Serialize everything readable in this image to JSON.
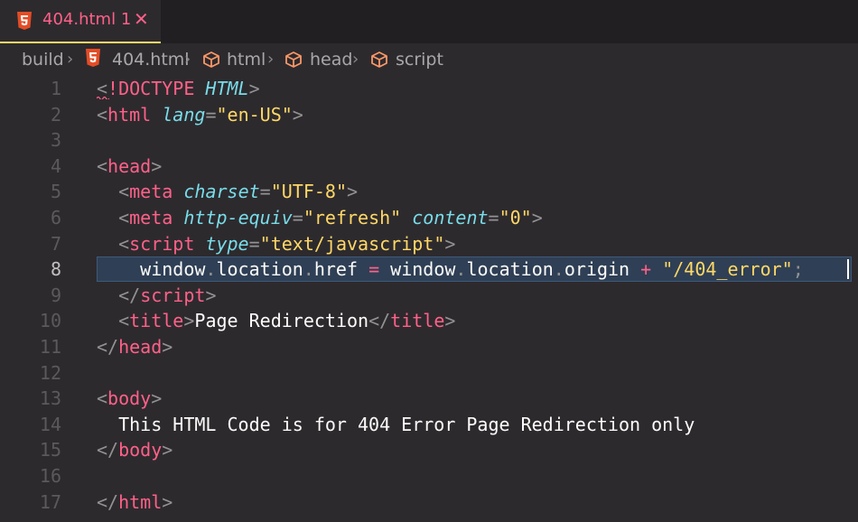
{
  "tab": {
    "filename": "404.html",
    "problem_count": "1",
    "close_glyph": "✕"
  },
  "breadcrumb": {
    "items": [
      "build",
      "404.html",
      "html",
      "head",
      "script"
    ],
    "separator": "›"
  },
  "colors": {
    "background": "#2d2a2e",
    "tag": "#ff6188",
    "attribute": "#78dce8",
    "string": "#ffd866",
    "punctuation": "#939293",
    "text": "#fcfcfa",
    "accent": "#ffd866"
  },
  "editor": {
    "active_line": "8",
    "lines": [
      {
        "n": "1",
        "parts": [
          [
            "p",
            "<"
          ],
          [
            "d",
            "!DOCTYPE"
          ],
          [
            "w",
            " "
          ],
          [
            "a",
            "HTML"
          ],
          [
            "p",
            ">"
          ]
        ]
      },
      {
        "n": "2",
        "parts": [
          [
            "p",
            "<"
          ],
          [
            "t",
            "html"
          ],
          [
            "w",
            " "
          ],
          [
            "a",
            "lang"
          ],
          [
            "p",
            "="
          ],
          [
            "s",
            "\"en-US\""
          ],
          [
            "p",
            ">"
          ]
        ]
      },
      {
        "n": "3",
        "parts": []
      },
      {
        "n": "4",
        "parts": [
          [
            "p",
            "<"
          ],
          [
            "t",
            "head"
          ],
          [
            "p",
            ">"
          ]
        ]
      },
      {
        "n": "5",
        "parts": [
          [
            "w",
            "  "
          ],
          [
            "p",
            "<"
          ],
          [
            "t",
            "meta"
          ],
          [
            "w",
            " "
          ],
          [
            "a",
            "charset"
          ],
          [
            "p",
            "="
          ],
          [
            "s",
            "\"UTF-8\""
          ],
          [
            "p",
            ">"
          ]
        ]
      },
      {
        "n": "6",
        "parts": [
          [
            "w",
            "  "
          ],
          [
            "p",
            "<"
          ],
          [
            "t",
            "meta"
          ],
          [
            "w",
            " "
          ],
          [
            "a",
            "http-equiv"
          ],
          [
            "p",
            "="
          ],
          [
            "s",
            "\"refresh\""
          ],
          [
            "w",
            " "
          ],
          [
            "a",
            "content"
          ],
          [
            "p",
            "="
          ],
          [
            "s",
            "\"0\""
          ],
          [
            "p",
            ">"
          ]
        ]
      },
      {
        "n": "7",
        "parts": [
          [
            "w",
            "  "
          ],
          [
            "p",
            "<"
          ],
          [
            "t",
            "script"
          ],
          [
            "w",
            " "
          ],
          [
            "a",
            "type"
          ],
          [
            "p",
            "="
          ],
          [
            "s",
            "\"text/javascript\""
          ],
          [
            "p",
            ">"
          ]
        ]
      },
      {
        "n": "8",
        "parts": [
          [
            "w",
            "    window"
          ],
          [
            "p",
            "."
          ],
          [
            "w",
            "location"
          ],
          [
            "p",
            "."
          ],
          [
            "w",
            "href "
          ],
          [
            "o",
            "="
          ],
          [
            "w",
            " window"
          ],
          [
            "p",
            "."
          ],
          [
            "w",
            "location"
          ],
          [
            "p",
            "."
          ],
          [
            "w",
            "origin "
          ],
          [
            "o",
            "+"
          ],
          [
            "w",
            " "
          ],
          [
            "s",
            "\"/404_error\""
          ],
          [
            "p",
            ";"
          ]
        ]
      },
      {
        "n": "9",
        "parts": [
          [
            "w",
            "  "
          ],
          [
            "p",
            "</"
          ],
          [
            "t",
            "script"
          ],
          [
            "p",
            ">"
          ]
        ]
      },
      {
        "n": "10",
        "parts": [
          [
            "w",
            "  "
          ],
          [
            "p",
            "<"
          ],
          [
            "t",
            "title"
          ],
          [
            "p",
            ">"
          ],
          [
            "w",
            "Page Redirection"
          ],
          [
            "p",
            "</"
          ],
          [
            "t",
            "title"
          ],
          [
            "p",
            ">"
          ]
        ]
      },
      {
        "n": "11",
        "parts": [
          [
            "p",
            "</"
          ],
          [
            "t",
            "head"
          ],
          [
            "p",
            ">"
          ]
        ]
      },
      {
        "n": "12",
        "parts": []
      },
      {
        "n": "13",
        "parts": [
          [
            "p",
            "<"
          ],
          [
            "t",
            "body"
          ],
          [
            "p",
            ">"
          ]
        ]
      },
      {
        "n": "14",
        "parts": [
          [
            "w",
            "  This HTML Code is for 404 Error Page Redirection only"
          ]
        ]
      },
      {
        "n": "15",
        "parts": [
          [
            "p",
            "</"
          ],
          [
            "t",
            "body"
          ],
          [
            "p",
            ">"
          ]
        ]
      },
      {
        "n": "16",
        "parts": []
      },
      {
        "n": "17",
        "parts": [
          [
            "p",
            "</"
          ],
          [
            "t",
            "html"
          ],
          [
            "p",
            ">"
          ]
        ]
      }
    ]
  }
}
